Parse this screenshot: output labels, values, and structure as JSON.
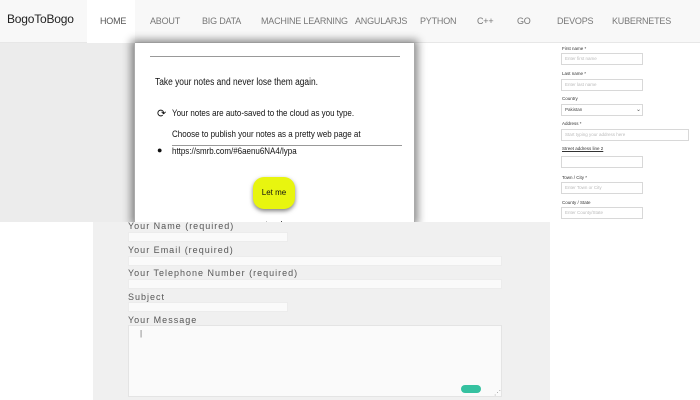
{
  "brand": "BogoToBogo",
  "nav": [
    {
      "label": "HOME",
      "active": true
    },
    {
      "label": "ABOUT"
    },
    {
      "label": "BIG DATA"
    },
    {
      "label": "MACHINE LEARNING"
    },
    {
      "label": "ANGULARJS"
    },
    {
      "label": "PYTHON"
    },
    {
      "label": "C++"
    },
    {
      "label": "GO"
    },
    {
      "label": "DEVOPS"
    },
    {
      "label": "KUBERNETES"
    }
  ],
  "promo": {
    "headline": "Take your notes and never lose them again.",
    "line1": "Your notes are auto-saved to the cloud as you type.",
    "line2": "Choose to publish your notes as a pretty web page at",
    "line3": "https://smrb.com/#6aenu6NA4/lypa",
    "button": "Let me type!"
  },
  "contact_form": {
    "name_label": "Your Name (required)",
    "email_label": "Your Email (required)",
    "phone_label": "Your Telephone Number (required)",
    "subject_label": "Subject",
    "message_label": "Your Message"
  },
  "sidebar_form": {
    "first_name_label": "First name *",
    "first_name_placeholder": "Enter first name",
    "last_name_label": "Last name *",
    "last_name_placeholder": "Enter last name",
    "country_label": "Country",
    "country_value": "Pakistan",
    "address_label": "Address *",
    "address_placeholder": "Start typing your address here",
    "address2_label": "Street address line 2",
    "town_label": "Town / City *",
    "town_placeholder": "Enter Town or City",
    "county_label": "County / State",
    "county_placeholder": "Enter County/State"
  },
  "colors": {
    "cta": "#e8f50f",
    "send": "#35c1a0"
  }
}
